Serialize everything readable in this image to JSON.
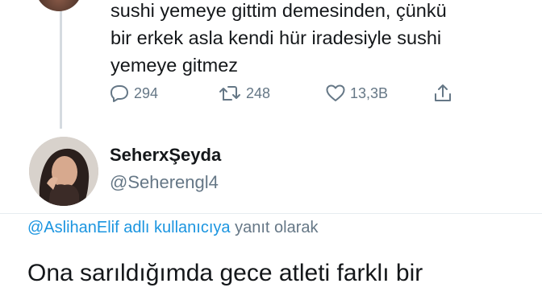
{
  "prev_tweet": {
    "text_lines": [
      "sushi yemeye gittim demesinden, çünkü",
      "bir erkek asla kendi hür iradesiyle sushi",
      "yemeye gitmez"
    ],
    "actions": {
      "replies": "294",
      "retweets": "248",
      "likes": "13,3B"
    }
  },
  "tweet": {
    "display_name": "SeherxŞeyda",
    "handle": "@Seherengl4",
    "reply_to_mention": "@AslihanElif adlı kullanıcıya",
    "reply_to_suffix": "yanıt olarak",
    "text": "Ona sarıldığımda gece atleti farklı bir"
  },
  "colors": {
    "text": "#14171a",
    "secondary": "#657786",
    "link": "#1b95e0"
  }
}
